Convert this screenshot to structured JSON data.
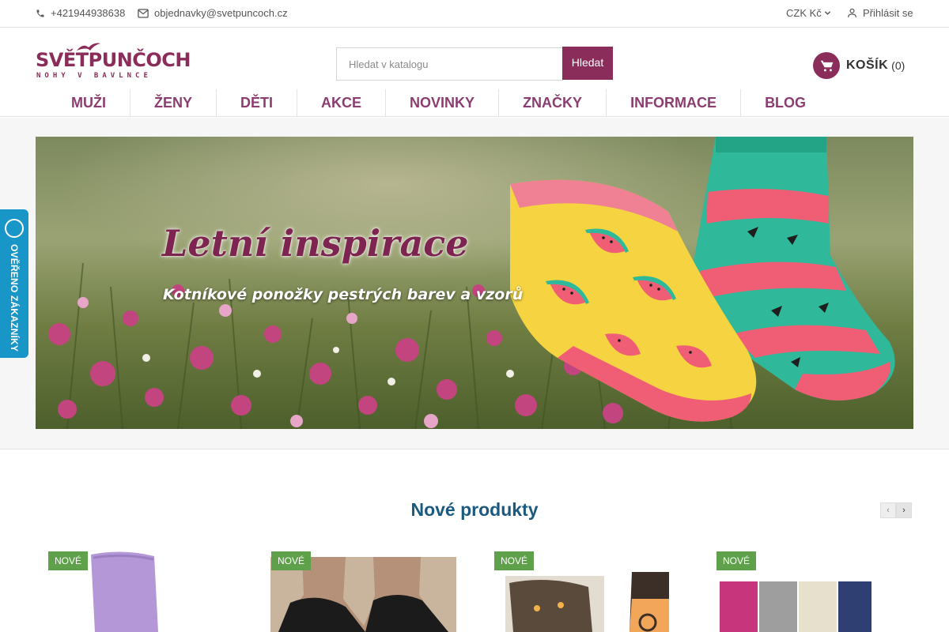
{
  "topbar": {
    "phone": "+421944938638",
    "email": "objednavky@svetpuncoch.cz",
    "currency": "CZK Kč",
    "login": "Přihlásit se"
  },
  "logo": {
    "main": "SVĚTPUNČOCH",
    "sub": "NOHY V BAVLNCE"
  },
  "search": {
    "placeholder": "Hledat v katalogu",
    "button": "Hledat"
  },
  "cart": {
    "label": "KOŠÍK",
    "count": "(0)"
  },
  "nav": [
    "MUŽI",
    "ŽENY",
    "DĚTI",
    "AKCE",
    "NOVINKY",
    "ZNAČKY",
    "INFORMACE",
    "BLOG"
  ],
  "banner": {
    "title": "Letní inspirace",
    "subtitle": "Kotníkové ponožky pestrých barev a vzorů"
  },
  "trust_badge": "OVĚŘENO ZÁKAZNÍKY",
  "products_section": {
    "title": "Nové produkty",
    "prev": "‹",
    "next": "›",
    "items": [
      {
        "badge": "NOVÉ"
      },
      {
        "badge": "NOVÉ"
      },
      {
        "badge": "NOVÉ"
      },
      {
        "badge": "NOVÉ"
      }
    ]
  },
  "colors": {
    "brand": "#8b2d5a",
    "nav_text": "#8b3d70",
    "section_title": "#1b5a7e",
    "badge_new": "#5fa14a",
    "trust": "#1996c8"
  }
}
